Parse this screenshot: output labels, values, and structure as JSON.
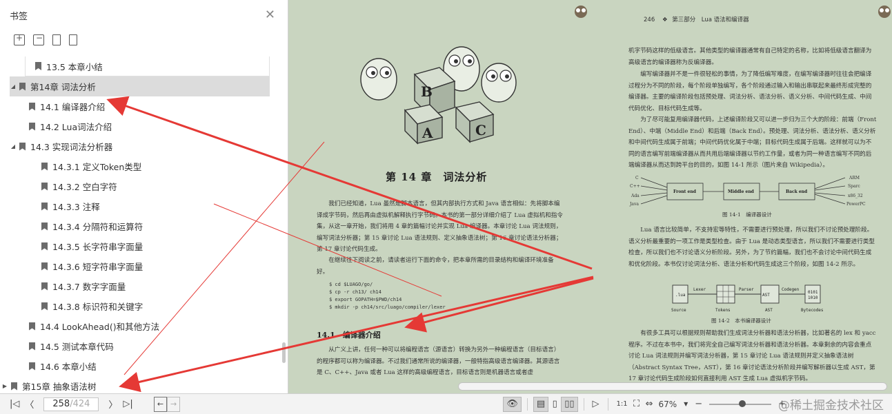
{
  "sidebar": {
    "title": "书签",
    "close_label": "✕",
    "tools": [
      "add-bookmark",
      "delete-bookmark",
      "bookmark",
      "bookmark-outline"
    ],
    "items": [
      {
        "label": "13.5 本章小结",
        "level": 1,
        "twisty": ""
      },
      {
        "label": "第14章 词法分析",
        "level": 0,
        "twisty": "◢"
      },
      {
        "label": "14.1 编译器介绍",
        "level": 1,
        "twisty": ""
      },
      {
        "label": "14.2 Lua词法介绍",
        "level": 1,
        "twisty": ""
      },
      {
        "label": "14.3 实现词法分析器",
        "level": 1,
        "twisty": "◢"
      },
      {
        "label": "14.3.1 定义Token类型",
        "level": 2,
        "twisty": ""
      },
      {
        "label": "14.3.2 空白字符",
        "level": 2,
        "twisty": ""
      },
      {
        "label": "14.3.3 注释",
        "level": 2,
        "twisty": ""
      },
      {
        "label": "14.3.4 分隔符和运算符",
        "level": 2,
        "twisty": ""
      },
      {
        "label": "14.3.5 长字符串字面量",
        "level": 2,
        "twisty": ""
      },
      {
        "label": "14.3.6 短字符串字面量",
        "level": 2,
        "twisty": ""
      },
      {
        "label": "14.3.7 数字字面量",
        "level": 2,
        "twisty": ""
      },
      {
        "label": "14.3.8 标识符和关键字",
        "level": 2,
        "twisty": ""
      },
      {
        "label": "14.4 LookAhead()和其他方法",
        "level": 1,
        "twisty": ""
      },
      {
        "label": "14.5 测试本章代码",
        "level": 1,
        "twisty": ""
      },
      {
        "label": "14.6 本章小结",
        "level": 1,
        "twisty": ""
      },
      {
        "label": "第15章 抽象语法树",
        "level": 0,
        "twisty": "▶"
      }
    ]
  },
  "left_page": {
    "illustration_letters": [
      "B",
      "A",
      "C"
    ],
    "chapter_title": "第 14 章　词法分析",
    "paragraphs": [
      "我们已经知道，Lua 虽然是脚本语言，但其内部执行方式和 Java 语言相似：先将脚本编译成字节码，然后再由虚拟机解释执行字节码。本书的第一部分详细介绍了 Lua 虚拟机和指令集，从这一章开始，我们将用 4 章的篇幅讨论并实现 Lua 编译器。本章讨论 Lua 词法规则，编写词法分析器；第 15 章讨论 Lua 语法规则、定义抽象语法树；第 16 章讨论语法分析器；第 17 章讨论代码生成。",
      "在继续往下阅读之前，请读者运行下面的命令，把本章所需的目录结构和编译环境准备好。"
    ],
    "code": "$ cd $LUAGO/go/\n$ cp -r ch13/ ch14\n$ export GOPATH=$PWD/ch14\n$ mkdir -p ch14/src/luago/compiler/lexer",
    "section_title": "14.1　编译器介绍",
    "section_text": "从广义上讲，任何一种可以将编程语言（源语言）转换为另外一种编程语言（目标语言）的程序都可以称为编译器。不过我们通常所说的编译器，一般特指高级语言编译器。其源语言是 C、C++、Java 或者 Lua 这样的高级编程语言，目标语言则是机器语言或者虚"
  },
  "right_page": {
    "page_number": "246",
    "header": "第三部分　Lua 语法和编译器",
    "para1": "机字节码这样的低级语言。其他类型的编译器通常有自己特定的名称，比如将低级语言翻译为高级语言的编译器称为反编译器。",
    "para2": "编写编译器并不是一件很轻松的事情，为了降低编写难度，在编写编译器时往往会把编译过程分为不同的阶段，每个阶段单独编写，各个阶段通过输入和输出串联起来最终形成完整的编译器。主要的编译阶段包括预处理、词法分析、语法分析、语义分析、中间代码生成、中间代码优化、目标代码生成等。",
    "para3": "为了尽可能复用编译器代码，上述编译阶段又可以进一步归为三个大的阶段：前端（Front End）、中端（Middle End）和后端（Back End）。预处理、词法分析、语法分析、语义分析和中间代码生成属于前端；中间代码优化属于中端；目标代码生成属于后端。这样就可以为不同的语言编写前端编译器从而共用后端编译器以节约工作量，或者为同一种语言编写不同的后端编译器从而达到跨平台的目的，如图 14-1 所示（图片来自 Wikipedia）。",
    "fig1": {
      "inputs": [
        "C",
        "C++",
        "Ada",
        "Java"
      ],
      "stages": [
        "Front end",
        "Middle end",
        "Back end"
      ],
      "outputs": [
        "ARM",
        "Sparc",
        "x86_32",
        "PowerPC"
      ],
      "caption": "图 14-1　编译器设计"
    },
    "para4": "Lua 语言比较简单，不支持宏等特性，不需要进行预处理，所以我们不讨论预处理阶段。语义分析最重要的一项工作是类型检查。由于 Lua 是动态类型语言，所以我们不需要进行类型检查，所以我们也不讨论语义分析阶段。另外，为了节约篇幅，我们也不会讨论中间代码生成和优化阶段。本书仅讨论词法分析、语法分析和代码生成这三个阶段，如图 14-2 所示。",
    "fig2": {
      "nodes": [
        ".lua",
        "Tokens",
        "AST",
        "0101\n1010"
      ],
      "node_labels": [
        "Source",
        "Tokens",
        "AST",
        "Bytecodes"
      ],
      "arrows": [
        "Lexer",
        "Parser",
        "Codegen"
      ],
      "caption": "图 14-2　本书编译器设计"
    },
    "para5": "有很多工具可以根据规则帮助我们生成词法分析器和语法分析器，比如著名的 lex 和 yacc 程序。不过在本书中，我们将完全自己编写词法分析器和语法分析器。本章剩余的内容会重点讨论 Lua 词法规则并编写词法分析器，第 15 章讨论 Lua 语法规则并定义抽象语法树（Abstract Syntax Tree，AST），第 16 章讨论语法分析阶段并编写解析器以生成 AST，第 17 章讨论代码生成阶段如何直接利用 AST 生成 Lua 虚拟机字节码。"
  },
  "toolbar": {
    "first": "|◁",
    "prev": "〈",
    "current_page": "258",
    "total_pages": "/424",
    "next": "〉",
    "last": "▷|",
    "zoom": "67%",
    "zoom_level": 0.67,
    "zoom_out": "−",
    "zoom_in": "+"
  },
  "watermark": "@稀土掘金技术社区",
  "colors": {
    "page_bg": "#c9d5c0",
    "arrow": "#e53935",
    "selected": "#dcdcdc"
  }
}
